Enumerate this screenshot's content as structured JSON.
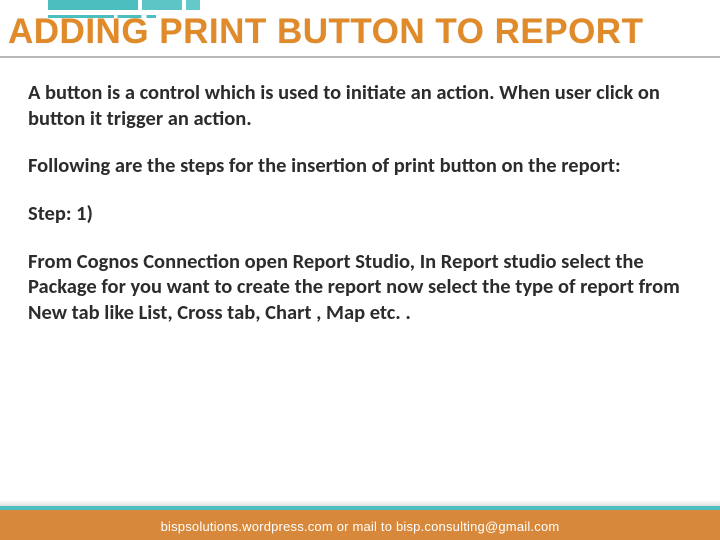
{
  "title": "ADDING PRINT BUTTON TO REPORT",
  "body": {
    "intro": "A button is a control which is used to initiate an action. When  user click on button it trigger an action.",
    "lead": "Following are the steps for the insertion of print button on the report:",
    "step_label": "Step: 1)",
    "step_body": "From Cognos Connection open Report Studio, In Report studio select the Package for you want to create the report now select the type of report from New tab like List, Cross tab, Chart , Map etc. ."
  },
  "footer": {
    "text": "bispsolutions.wordpress.com or mail to bisp.consulting@gmail.com"
  }
}
